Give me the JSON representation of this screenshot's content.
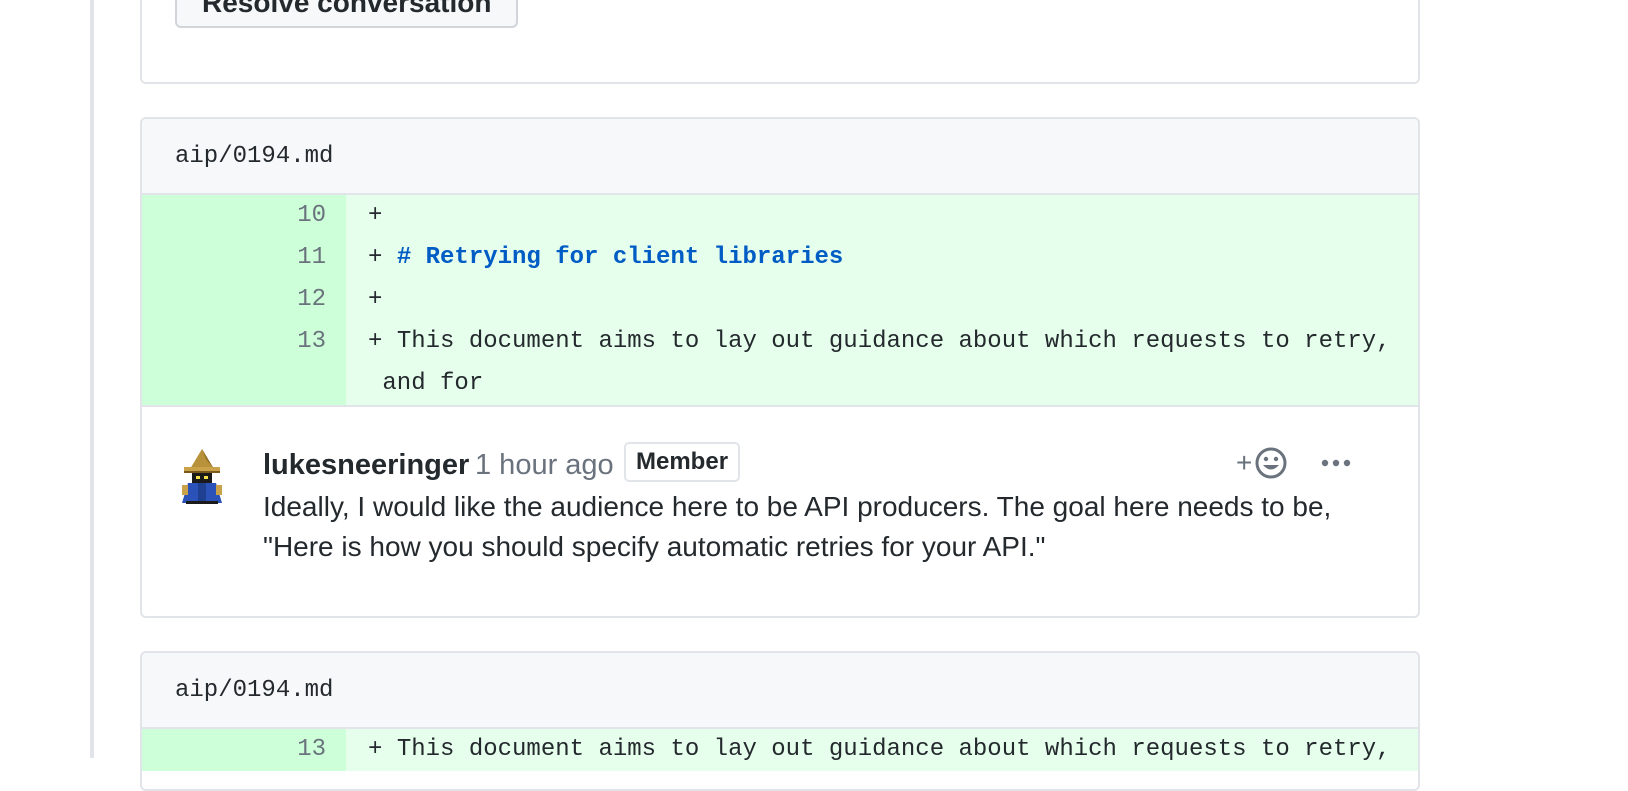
{
  "previous_thread": {
    "resolve_label": "Resolve conversation"
  },
  "threads": [
    {
      "file_path": "aip/0194.md",
      "lines": [
        {
          "number": "10",
          "prefix": "+",
          "text": "",
          "heading": ""
        },
        {
          "number": "11",
          "prefix": "+ ",
          "text": "",
          "heading": "# Retrying for client libraries"
        },
        {
          "number": "12",
          "prefix": "+",
          "text": "",
          "heading": ""
        },
        {
          "number": "13",
          "prefix": "+ ",
          "text": "This document aims to lay out guidance about which requests to retry,\n and for",
          "heading": ""
        }
      ],
      "comment": {
        "author": "lukesneeringer",
        "timestamp": "1 hour ago",
        "badge": "Member",
        "body_line1": "Ideally, I would like the audience here to be API producers. The goal here needs to be,",
        "body_line2": "\"Here is how you should specify automatic retries for your API.\"",
        "react_plus": "+",
        "icons": {
          "avatar": "wizard-avatar",
          "reaction": "smiley-icon",
          "more": "kebab-icon"
        }
      }
    },
    {
      "file_path": "aip/0194.md",
      "lines": [
        {
          "number": "13",
          "prefix": "+ ",
          "text": "This document aims to lay out guidance about which requests to retry,",
          "heading": ""
        }
      ]
    }
  ],
  "colors": {
    "addition_code_bg": "#e6ffec",
    "addition_num_bg": "#cdffd8",
    "heading_blue": "#005cc5",
    "border": "#e1e4e8"
  }
}
